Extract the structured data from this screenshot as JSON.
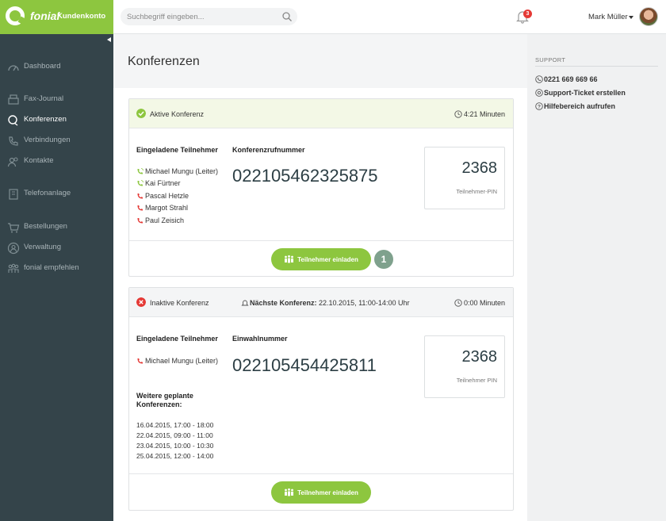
{
  "app": {
    "brand": "fonial",
    "subtitle": "Kundenkonto"
  },
  "search": {
    "placeholder": "Suchbegriff eingeben..."
  },
  "notifications": {
    "count": "3"
  },
  "user": {
    "name": "Mark Müller"
  },
  "sidebar": {
    "items": [
      {
        "label": "Dashboard",
        "icon": "dashboard-icon"
      },
      {
        "label": "Fax-Journal",
        "icon": "fax-icon"
      },
      {
        "label": "Konferenzen",
        "icon": "conference-icon",
        "active": true
      },
      {
        "label": "Verbindungen",
        "icon": "phone-icon"
      },
      {
        "label": "Kontakte",
        "icon": "contacts-icon"
      },
      {
        "label": "Telefonanlage",
        "icon": "phone-system-icon"
      },
      {
        "label": "Bestellungen",
        "icon": "cart-icon"
      },
      {
        "label": "Verwaltung",
        "icon": "user-icon"
      },
      {
        "label": "fonial empfehlen",
        "icon": "recommend-icon"
      }
    ]
  },
  "page": {
    "title": "Konferenzen"
  },
  "support": {
    "title": "SUPPORT",
    "phone": "0221 669 669 66",
    "ticket": "Support-Ticket erstellen",
    "help": "Hilfebereich aufrufen"
  },
  "active_conference": {
    "status": "Aktive Konferenz",
    "duration": "4:21 Minuten",
    "participants_label": "Eingeladene Teilnehmer",
    "number_label": "Konferenzrufnummer",
    "number": "022105462325875",
    "pin": "2368",
    "pin_label": "Teilnehmer-PIN",
    "participants": [
      {
        "name": "Michael Mungu (Leiter)",
        "state": "connected"
      },
      {
        "name": "Kai Fürtner",
        "state": "connected"
      },
      {
        "name": "Pascal Hetzle",
        "state": "disconnected"
      },
      {
        "name": "Margot Strahl",
        "state": "disconnected"
      },
      {
        "name": "Paul Zeisich",
        "state": "disconnected"
      }
    ],
    "invite_label": "Teilnehmer einladen",
    "invite_count": "1"
  },
  "inactive_conference": {
    "status": "Inaktive Konferenz",
    "next_label": "Nächste Konferenz:",
    "next_value": "22.10.2015, 11:00-14:00 Uhr",
    "duration": "0:00 Minuten",
    "participants_label": "Eingeladene Teilnehmer",
    "number_label": "Einwahlnummer",
    "number": "022105454425811",
    "pin": "2368",
    "pin_label": "Teilnehmer PIN",
    "participants": [
      {
        "name": "Michael Mungu (Leiter)",
        "state": "disconnected"
      }
    ],
    "planned_label_1": "Weitere geplante",
    "planned_label_2": "Konferenzen:",
    "planned": [
      "16.04.2015, 17:00 - 18:00",
      "22.04.2015, 09:00 - 11:00",
      "23.04.2015, 10:00 - 10:30",
      "25.04.2015, 12:00 - 14:00"
    ],
    "invite_label": "Teilnehmer einladen"
  },
  "colors": {
    "brand": "#8dc63f",
    "sidebar": "#34444a",
    "connected": "#8dc63f",
    "disconnected": "#e53935"
  }
}
